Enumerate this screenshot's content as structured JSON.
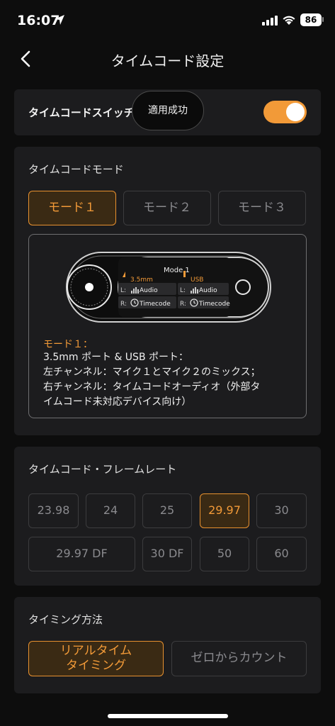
{
  "status_bar": {
    "time": "16:07",
    "battery": "86"
  },
  "header": {
    "title": "タイムコード設定"
  },
  "switch_section": {
    "label": "タイムコードスイッチ",
    "toast": "適用成功",
    "enabled": true
  },
  "mode_section": {
    "title": "タイムコードモード",
    "modes": [
      "モード１",
      "モード２",
      "モード３"
    ],
    "selected": 0,
    "device": {
      "screen_title": "Mode 1",
      "port_left": "3.5mm",
      "port_right": "USB",
      "l_prefix": "L:",
      "r_prefix": "R:",
      "audio": "Audio",
      "timecode": "Timecode"
    },
    "description_heading": "モード１：",
    "description_lines": [
      "3.5mm ポート & USB ポート：",
      "左チャンネル：マイク１とマイク２のミックス；",
      "右チャンネル：タイムコードオーディオ（外部タ",
      "イムコード未対応デバイス向け）"
    ]
  },
  "fps_section": {
    "title": "タイムコード・フレームレート",
    "row1": [
      "23.98",
      "24",
      "25",
      "29.97",
      "30"
    ],
    "row2": [
      "29.97 DF",
      "30 DF",
      "50",
      "60"
    ],
    "selected": "29.97"
  },
  "timing_section": {
    "title": "タイミング方法",
    "options": [
      "リアルタイム\nタイミング",
      "ゼロからカウント"
    ],
    "option1_line1": "リアルタイム",
    "option1_line2": "タイミング",
    "option2": "ゼロからカウント",
    "selected": 0
  },
  "colors": {
    "accent": "#f29a38",
    "card": "#1c1c1e",
    "background": "#0d0d0d"
  }
}
